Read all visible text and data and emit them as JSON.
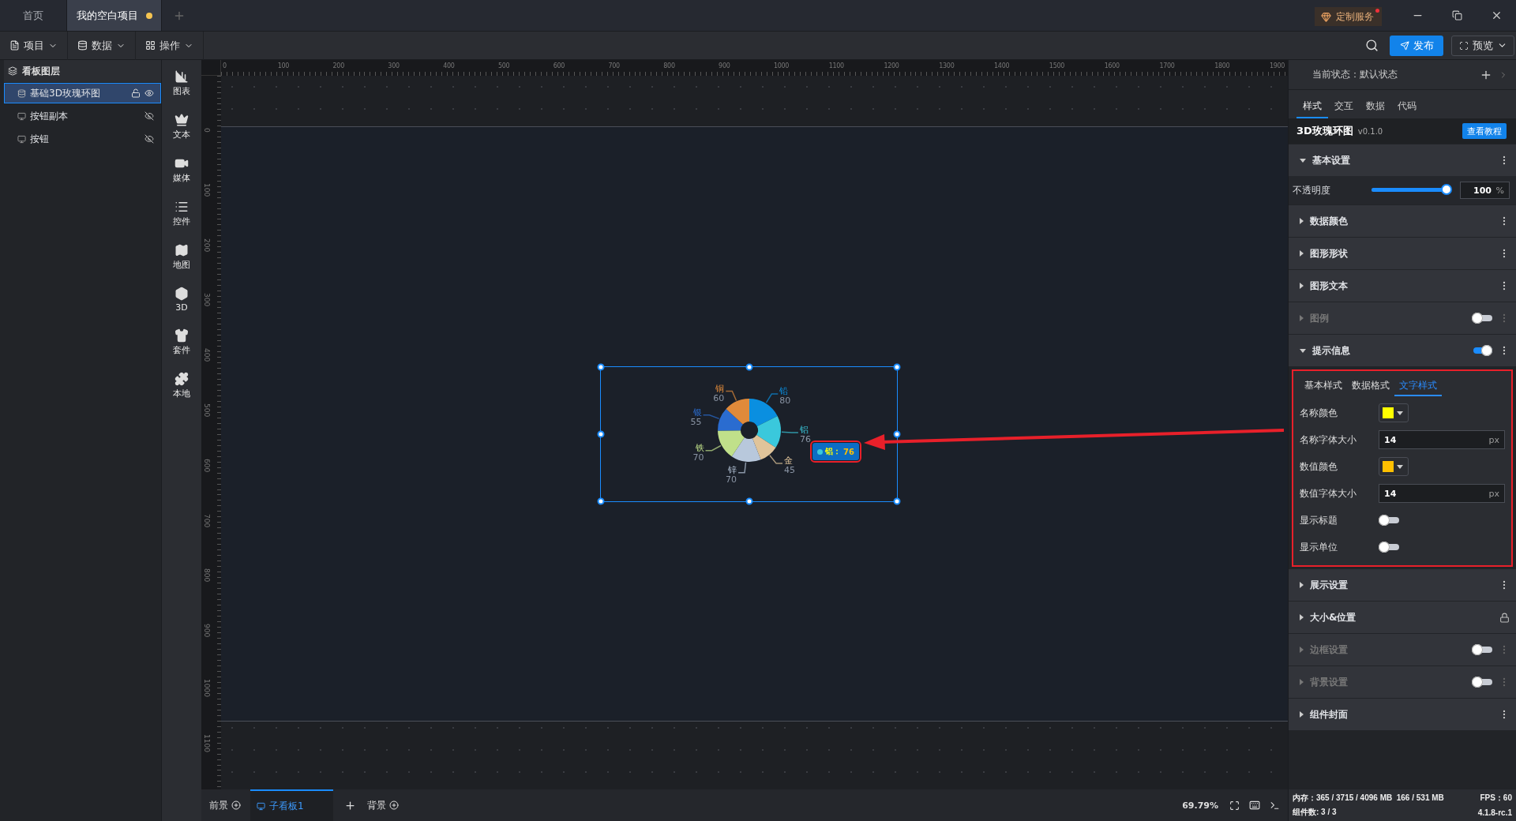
{
  "tabs": [
    {
      "label": "首页",
      "selected": false,
      "unsaved": false
    },
    {
      "label": "我的空白项目",
      "selected": true,
      "unsaved": true
    }
  ],
  "custom_service": {
    "label": "定制服务",
    "badge": true
  },
  "toolbar": {
    "menus": [
      {
        "label": "项目"
      },
      {
        "label": "数据"
      },
      {
        "label": "操作"
      }
    ],
    "publish": "发布",
    "preview": "预览"
  },
  "layers": {
    "title": "看板图层",
    "items": [
      {
        "name": "基础3D玫瑰环图",
        "kind": "chart",
        "selected": true,
        "locked": false,
        "visible": true
      },
      {
        "name": "按钮副本",
        "kind": "button",
        "selected": false,
        "visible": false
      },
      {
        "name": "按钮",
        "kind": "button",
        "selected": false,
        "visible": false
      }
    ]
  },
  "palette": [
    {
      "label": "图表"
    },
    {
      "label": "文本"
    },
    {
      "label": "媒体"
    },
    {
      "label": "控件"
    },
    {
      "label": "地图"
    },
    {
      "label": "3D"
    },
    {
      "label": "套件"
    },
    {
      "label": "本地"
    }
  ],
  "ruler": {
    "x_labels": [
      "0",
      "100",
      "200",
      "300",
      "400",
      "500",
      "600",
      "700",
      "800",
      "900",
      "1000",
      "1100",
      "1200",
      "1300",
      "1400",
      "1500",
      "1600",
      "1700",
      "1800",
      "1900"
    ],
    "y_labels": [
      "0",
      "100",
      "200",
      "300",
      "400",
      "500",
      "600",
      "700",
      "800",
      "900",
      "1000",
      "1100"
    ]
  },
  "widget": {
    "chart_data": {
      "type": "donut",
      "categories": [
        "铅",
        "铝",
        "金",
        "锌",
        "铁",
        "银",
        "铜"
      ],
      "values": [
        80,
        76,
        45,
        70,
        70,
        55,
        60
      ],
      "colors": [
        "#0a8fe0",
        "#3ac8dc",
        "#e0c49a",
        "#b8c8dc",
        "#c0e08a",
        "#2a6cd0",
        "#e08a3a"
      ],
      "data_labels": true
    },
    "tooltip": {
      "label": "铝：",
      "value": "76",
      "color": "#3ac8dc",
      "highlighted": true
    }
  },
  "bottom": {
    "foreground": "前景",
    "boards": [
      {
        "label": "子看板1",
        "selected": true
      }
    ],
    "background": "背景",
    "zoom": "69.79%"
  },
  "panel": {
    "state_label": "当前状态：默认状态",
    "tabs": [
      {
        "label": "样式",
        "selected": true
      },
      {
        "label": "交互",
        "selected": false
      },
      {
        "label": "数据",
        "selected": false
      },
      {
        "label": "代码",
        "selected": false
      }
    ],
    "component": {
      "name": "3D玫瑰环图",
      "version": "v0.1.0",
      "tutorial": "查看教程"
    },
    "sections": [
      {
        "title": "基本设置",
        "kind": "menu",
        "expanded": true,
        "opacity": {
          "label": "不透明度",
          "level": 1,
          "value": "100",
          "unit": "%"
        }
      },
      {
        "title": "数据颜色",
        "kind": "menu",
        "expanded": false
      },
      {
        "title": "图形形状",
        "kind": "menu",
        "expanded": false
      },
      {
        "title": "图形文本",
        "kind": "menu",
        "expanded": false
      },
      {
        "title": "图例",
        "kind": "toggle",
        "on": false,
        "expanded": false
      },
      {
        "title": "提示信息",
        "kind": "toggle",
        "on": true,
        "expanded": true,
        "subpanel": {
          "highlighted": true,
          "tabs": [
            {
              "label": "基本样式",
              "selected": false
            },
            {
              "label": "数据格式",
              "selected": false
            },
            {
              "label": "文字样式",
              "selected": true
            }
          ],
          "fields": [
            {
              "kind": "color",
              "label": "名称颜色",
              "color": "#ffff00"
            },
            {
              "kind": "number",
              "label": "名称字体大小",
              "value": "14",
              "unit": "px"
            },
            {
              "kind": "color",
              "label": "数值颜色",
              "color": "#ffc000"
            },
            {
              "kind": "number",
              "label": "数值字体大小",
              "value": "14",
              "unit": "px"
            },
            {
              "kind": "switch",
              "label": "显示标题",
              "on": false
            },
            {
              "kind": "switch",
              "label": "显示单位",
              "on": false
            }
          ]
        }
      },
      {
        "title": "展示设置",
        "kind": "menu",
        "expanded": false
      },
      {
        "title": "大小&位置",
        "kind": "lock",
        "expanded": false
      },
      {
        "title": "边框设置",
        "kind": "toggle",
        "on": false,
        "expanded": false
      },
      {
        "title": "背景设置",
        "kind": "toggle",
        "on": false,
        "expanded": false
      },
      {
        "title": "组件封面",
        "kind": "menu",
        "expanded": false
      }
    ],
    "footer": {
      "memory": "内存：365 / 3715 / 4096 MB  166 / 531 MB",
      "fps": "FPS：60",
      "count": "组件数: 3 / 3",
      "version": "4.1.8-rc.1"
    }
  },
  "annotation_arrow": true
}
